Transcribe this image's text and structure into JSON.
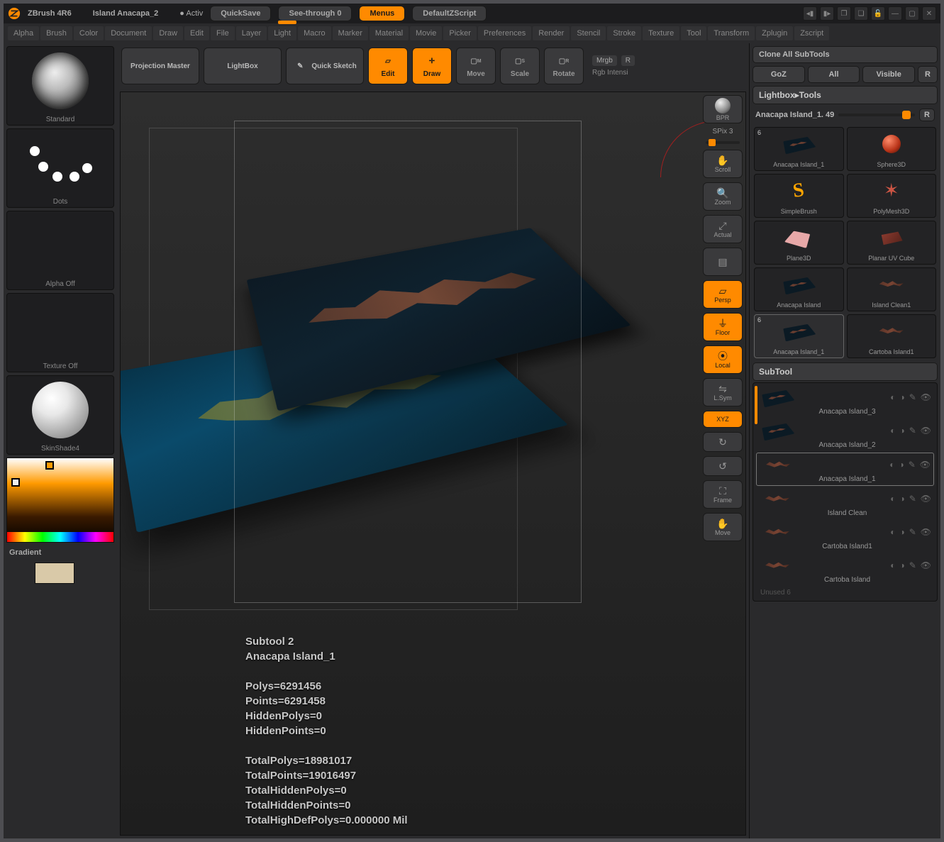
{
  "titlebar": {
    "app": "ZBrush 4R6",
    "project": "Island Anacapa_2",
    "active": "● Activ",
    "quicksave": "QuickSave",
    "seethrough": "See-through  0",
    "menus": "Menus",
    "defaultz": "DefaultZScript"
  },
  "menubar": [
    "Alpha",
    "Brush",
    "Color",
    "Document",
    "Draw",
    "Edit",
    "File",
    "Layer",
    "Light",
    "Macro",
    "Marker",
    "Material",
    "Movie",
    "Picker",
    "Preferences",
    "Render",
    "Stencil",
    "Stroke",
    "Texture",
    "Tool",
    "Transform",
    "Zplugin",
    "Zscript"
  ],
  "shelf": {
    "proj_master": "Projection Master",
    "lightbox": "LightBox",
    "quick_sketch": "Quick Sketch",
    "standard": "Standard",
    "dots": "Dots",
    "alpha_off": "Alpha Off",
    "texture_off": "Texture Off",
    "skinshade": "SkinShade4",
    "gradient": "Gradient"
  },
  "toolrow": {
    "edit": "Edit",
    "draw": "Draw",
    "move": "Move",
    "scale": "Scale",
    "rotate": "Rotate",
    "mrgb": "Mrgb",
    "r": "R",
    "rgb_intens": "Rgb Intensi"
  },
  "dock": {
    "bpr": "BPR",
    "spix": "SPix 3",
    "scroll": "Scroll",
    "zoom": "Zoom",
    "actual": "Actual",
    "persp": "Persp",
    "floor": "Floor",
    "local": "Local",
    "lsym": "L.Sym",
    "xyz": "XYZ",
    "frame": "Frame",
    "move": "Move"
  },
  "overlay": {
    "line1": "Subtool 2",
    "line2": "Anacapa Island_1",
    "line3": "Polys=6291456",
    "line4": "Points=6291458",
    "line5": "HiddenPolys=0",
    "line6": "HiddenPoints=0",
    "line7": "TotalPolys=18981017",
    "line8": "TotalPoints=19016497",
    "line9": "TotalHiddenPolys=0",
    "line10": "TotalHiddenPoints=0",
    "line11": "TotalHighDefPolys=0.000000 Mil"
  },
  "right": {
    "clone_all": "Clone All SubTools",
    "goz": "GoZ",
    "all": "All",
    "visible": "Visible",
    "r": "R",
    "lightbox_tools": "Lightbox▸Tools",
    "slider_label": "Anacapa Island_1. 49",
    "tools": [
      {
        "label": "Anacapa Island_1",
        "kind": "slab",
        "badge": "6"
      },
      {
        "label": "Sphere3D",
        "kind": "sphere"
      },
      {
        "label": "SimpleBrush",
        "kind": "s"
      },
      {
        "label": "PolyMesh3D",
        "kind": "star"
      },
      {
        "label": "Plane3D",
        "kind": "plane"
      },
      {
        "label": "Planar UV Cube",
        "kind": "cube"
      },
      {
        "label": "Anacapa Island",
        "kind": "slab"
      },
      {
        "label": "Island Clean1",
        "kind": "island"
      },
      {
        "label": "Anacapa Island_1",
        "kind": "slab",
        "badge": "6",
        "sel": true
      },
      {
        "label": "Cartoba Island1",
        "kind": "island"
      }
    ],
    "subtool_header": "SubTool",
    "subtools": [
      {
        "label": "Anacapa Island_3",
        "kind": "slab"
      },
      {
        "label": "Anacapa Island_2",
        "kind": "slab"
      },
      {
        "label": "Anacapa Island_1",
        "kind": "island",
        "sel": true
      },
      {
        "label": "Island Clean",
        "kind": "island"
      },
      {
        "label": "Cartoba Island1",
        "kind": "island"
      },
      {
        "label": "Cartoba Island",
        "kind": "island"
      }
    ],
    "unused": "Unused 6"
  }
}
